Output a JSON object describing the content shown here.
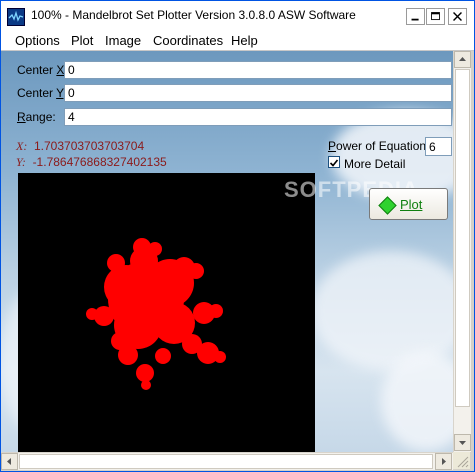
{
  "window": {
    "title": "100% - Mandelbrot Set Plotter Version 3.0.8.0  ASW Software",
    "icon": "mandelbrot-app-icon"
  },
  "title_buttons": {
    "minimize": "minimize-icon",
    "maximize": "maximize-icon",
    "close": "close-icon"
  },
  "menu": {
    "items": [
      "Options",
      "Plot",
      "Image",
      "Coordinates",
      "Help"
    ]
  },
  "fields": {
    "center_x": {
      "label_prefix": "Center ",
      "label_key": "X",
      "label_suffix": ":",
      "value": "0"
    },
    "center_y": {
      "label_prefix": "Center ",
      "label_key": "Y",
      "label_suffix": ":",
      "value": "0"
    },
    "range": {
      "label_prefix": "",
      "label_key": "R",
      "label_suffix": "ange:",
      "value": "4"
    }
  },
  "cursor_coords": {
    "x_label": "X:",
    "x_value": "1.703703703703704",
    "y_label": "Y:",
    "y_value": "-1.786476868327402135"
  },
  "options": {
    "power_label_prefix": "",
    "power_label_key": "P",
    "power_label_suffix": "ower of Equation:",
    "power_value": "6",
    "more_detail_label": "More Detail",
    "more_detail_checked": true
  },
  "plot_button": {
    "label": "Plot",
    "icon": "green-gem-icon"
  },
  "watermark": "SOFTPEDIA",
  "colors": {
    "fractal": "#ff0000",
    "canvas_bg": "#000000",
    "coord_text": "#8b1a1a",
    "plot_label": "#108010"
  }
}
